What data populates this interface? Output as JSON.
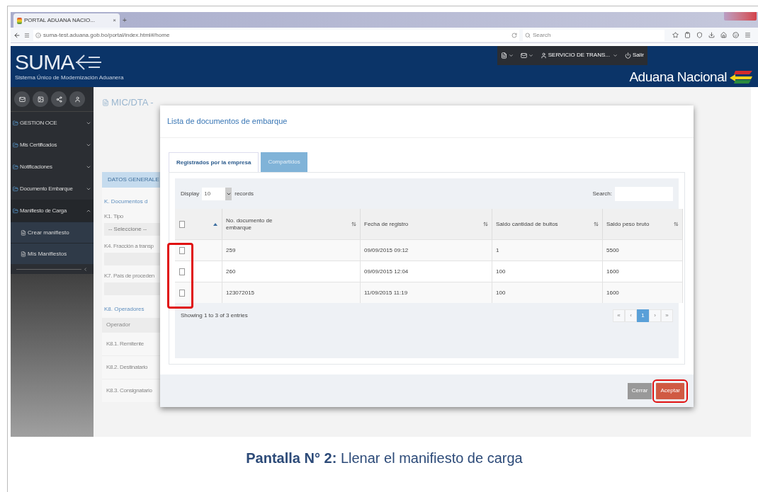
{
  "browser": {
    "tab_title": "PORTAL ADUANA NACIO...",
    "tab_close": "×",
    "new_tab": "+",
    "address": "suma-test.aduana.gob.bo/portal/index.html#/home",
    "search_placeholder": "Search"
  },
  "header": {
    "logo": "SUMA",
    "logo_subtitle": "Sistema Único de Modernización Aduanera",
    "user": "SERVICIO DE TRANS...",
    "logout": "Salir",
    "brand": "Aduana Nacional"
  },
  "sidebar": {
    "items": [
      {
        "label": "GESTION OCE",
        "expanded": false
      },
      {
        "label": "Mis Certificados",
        "expanded": false
      },
      {
        "label": "Notificaciones",
        "expanded": false
      },
      {
        "label": "Documento Embarque",
        "expanded": false
      },
      {
        "label": "Manifiesto de Carga",
        "expanded": true,
        "children": [
          {
            "label": "Crear manifiesto"
          },
          {
            "label": "Mis Manifiestos"
          }
        ]
      }
    ]
  },
  "page": {
    "title": "MIC/DTA -",
    "tab": "DATOS GENERALE",
    "section": "K. Documentos d",
    "fields": [
      {
        "label": "K1. Tipo",
        "value": "-- Seleccione --"
      },
      {
        "label": "K4. Fracción a transp"
      },
      {
        "label": "K7. País de proceden"
      }
    ],
    "operators_title": "K8. Operadores",
    "operators_header": "Operador",
    "operators": [
      "K8.1. Remitente",
      "K8.2. Destinatario",
      "K8.3. Consignatario"
    ]
  },
  "modal": {
    "title": "Lista de documentos de embarque",
    "tabs": [
      {
        "label": "Registrados por la empresa",
        "selected": true
      },
      {
        "label": "Compartidos",
        "selected": false
      }
    ],
    "select_all_checked": false,
    "display_label": "Display",
    "page_size": "10",
    "records_label": "records",
    "search_label": "Search:",
    "columns": [
      "No. documento de embarque",
      "Fecha de registro",
      "Saldo cantidad de bultos",
      "Saldo peso bruto"
    ],
    "rows": [
      {
        "checked": false,
        "cells": [
          "259",
          "09/09/2015 09:12",
          "1",
          "5500"
        ]
      },
      {
        "checked": false,
        "cells": [
          "260",
          "09/09/2015 12:04",
          "100",
          "1600"
        ]
      },
      {
        "checked": false,
        "cells": [
          "123072015",
          "11/09/2015 11:19",
          "100",
          "1600"
        ]
      }
    ],
    "info": "Showing 1 to 3 of 3 entries",
    "pages": [
      {
        "label": "«",
        "selected": false
      },
      {
        "label": "‹",
        "selected": false
      },
      {
        "label": "1",
        "selected": true
      },
      {
        "label": "›",
        "selected": false
      },
      {
        "label": "»",
        "selected": false
      }
    ],
    "buttons": [
      {
        "label": "Cerrar",
        "kind": "secondary"
      },
      {
        "label": "Aceptar",
        "kind": "primary"
      }
    ]
  },
  "caption": "**Pantalla N° 2:** Llenar el manifiesto de carga"
}
